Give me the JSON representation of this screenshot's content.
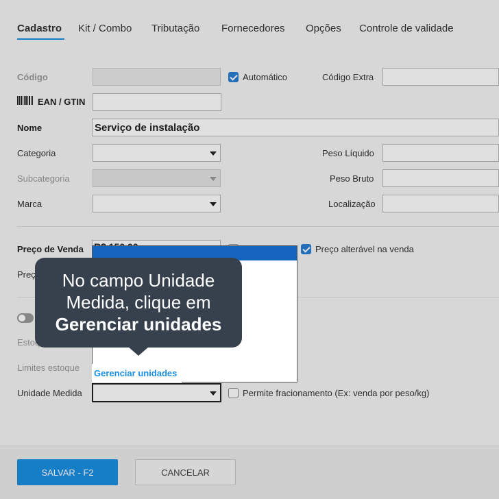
{
  "tabs": [
    {
      "label": "Cadastro",
      "active": true
    },
    {
      "label": "Kit / Combo"
    },
    {
      "label": "Tributação"
    },
    {
      "label": "Fornecedores"
    },
    {
      "label": "Opções"
    },
    {
      "label": "Controle de validade"
    }
  ],
  "form": {
    "codigo_label": "Código",
    "codigo_value": "",
    "automatico_label": "Automático",
    "codigo_extra_label": "Código Extra",
    "ean_label": "EAN / GTIN",
    "nome_label": "Nome",
    "nome_value": "Serviço de instalação",
    "categoria_label": "Categoria",
    "subcategoria_label": "Subcategoria",
    "marca_label": "Marca",
    "peso_liquido_label": "Peso Líquido",
    "peso_bruto_label": "Peso Bruto",
    "localizacao_label": "Localização",
    "preco_venda_label": "Preço de Venda",
    "preco_venda_value": "R$ 150,00",
    "preco_alteravel_label": "Preço alterável na venda",
    "preco_custo_label": "Preç",
    "estoque_label": "Estoq",
    "limites_estoque_label": "Limites estoque",
    "unidade_medida_label": "Unidade Medida",
    "permite_fracionamento_label": "Permite fracionamento (Ex: venda por peso/kg)"
  },
  "dropdown": {
    "manage_units_label": "Gerenciar unidades"
  },
  "tooltip": {
    "line1": "No campo Unidade",
    "line2": "Medida, clique em",
    "line3": "Gerenciar unidades"
  },
  "footer": {
    "save_label": "SALVAR - F2",
    "cancel_label": "CANCELAR"
  },
  "colors": {
    "accent": "#1a8fe3",
    "tooltip_bg": "#37404d",
    "dropdown_highlight": "#1565c0"
  }
}
